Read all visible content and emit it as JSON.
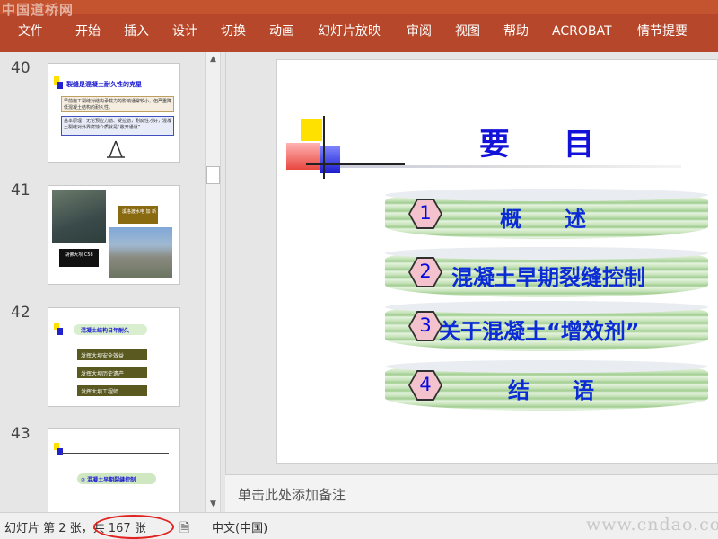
{
  "watermark_top": "中国道桥网",
  "ribbon": {
    "tabs": [
      "文件",
      "开始",
      "插入",
      "设计",
      "切换",
      "动画",
      "幻灯片放映",
      "审阅",
      "视图",
      "帮助",
      "ACROBAT",
      "情节提要"
    ]
  },
  "thumbnails": [
    {
      "number": "40",
      "title": "裂缝是混凝土耐久性的克星",
      "lines": [
        "早前施工裂缝对结构承载力的影响通常较小，但严重降低混凝土结构的耐久性。",
        "基本原理：无论预应力筋、受拉筋，耐腐性才好，混凝土裂缝对外界腐蚀介质就是“敞开通道”"
      ]
    },
    {
      "number": "41",
      "labels": [
        "溪洛渡水电 加 新",
        "胡佛大坝 C58"
      ]
    },
    {
      "number": "42",
      "title": "混凝土结构日年耐久",
      "buttons": [
        "发挥大坝安全效益",
        "发挥大坝历史遗产",
        "发挥大坝工程师"
      ]
    },
    {
      "number": "43",
      "item": "② 混凝土早期裂缝控制"
    }
  ],
  "slide": {
    "title": "要目",
    "items": [
      {
        "number": "1",
        "label": "概　　述"
      },
      {
        "number": "2",
        "label": "混凝土早期裂缝控制"
      },
      {
        "number": "3",
        "label": "关于混凝土“增效剂”"
      },
      {
        "number": "4",
        "label": "结　　语"
      }
    ]
  },
  "notes": {
    "placeholder": "单击此处添加备注"
  },
  "status": {
    "slide_info": "幻灯片 第 2 张，共 167 张",
    "language": "中文(中国)",
    "watermark": "www.cndao.com"
  }
}
